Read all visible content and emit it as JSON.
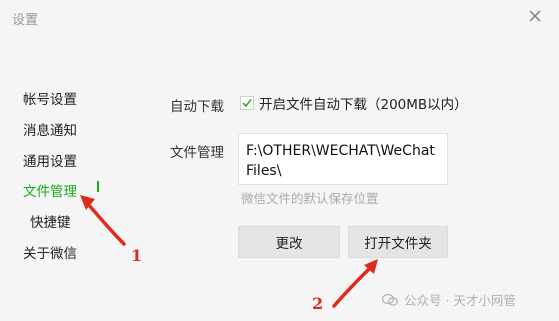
{
  "window": {
    "title": "设置"
  },
  "sidebar": {
    "items": [
      {
        "label": "帐号设置"
      },
      {
        "label": "消息通知"
      },
      {
        "label": "通用设置"
      },
      {
        "label": "文件管理"
      },
      {
        "label": "快捷键"
      },
      {
        "label": "关于微信"
      }
    ],
    "active_index": 3
  },
  "main": {
    "auto_download_label": "自动下载",
    "auto_download_checkbox_label": "开启文件自动下载（200MB以内）",
    "auto_download_checked": true,
    "file_mgmt_label": "文件管理",
    "path_value": "F:\\OTHER\\WECHAT\\WeChat Files\\",
    "path_hint": "微信文件的默认保存位置",
    "change_button": "更改",
    "open_folder_button": "打开文件夹"
  },
  "annotations": {
    "marker_1": "1",
    "marker_2": "2",
    "color": "#e02a1e"
  },
  "watermark": {
    "text": "公众号 · 天才小网管"
  },
  "colors": {
    "accent": "#1aad19"
  }
}
